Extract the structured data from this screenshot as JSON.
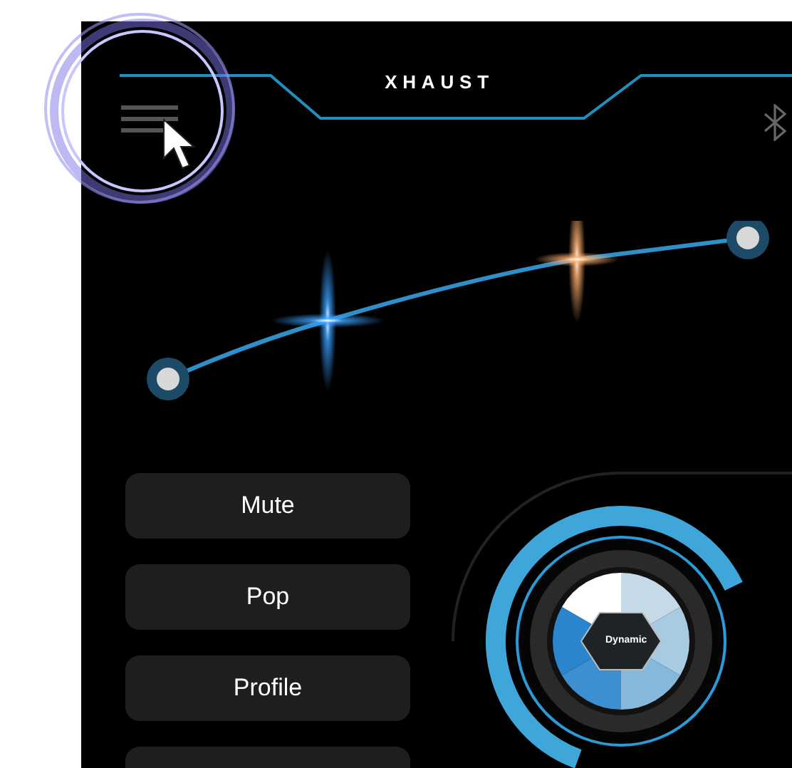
{
  "header": {
    "title": "XHAUST"
  },
  "buttons": [
    {
      "label": "Mute"
    },
    {
      "label": "Pop"
    },
    {
      "label": "Profile"
    }
  ],
  "dial": {
    "label": "Dynamic"
  }
}
